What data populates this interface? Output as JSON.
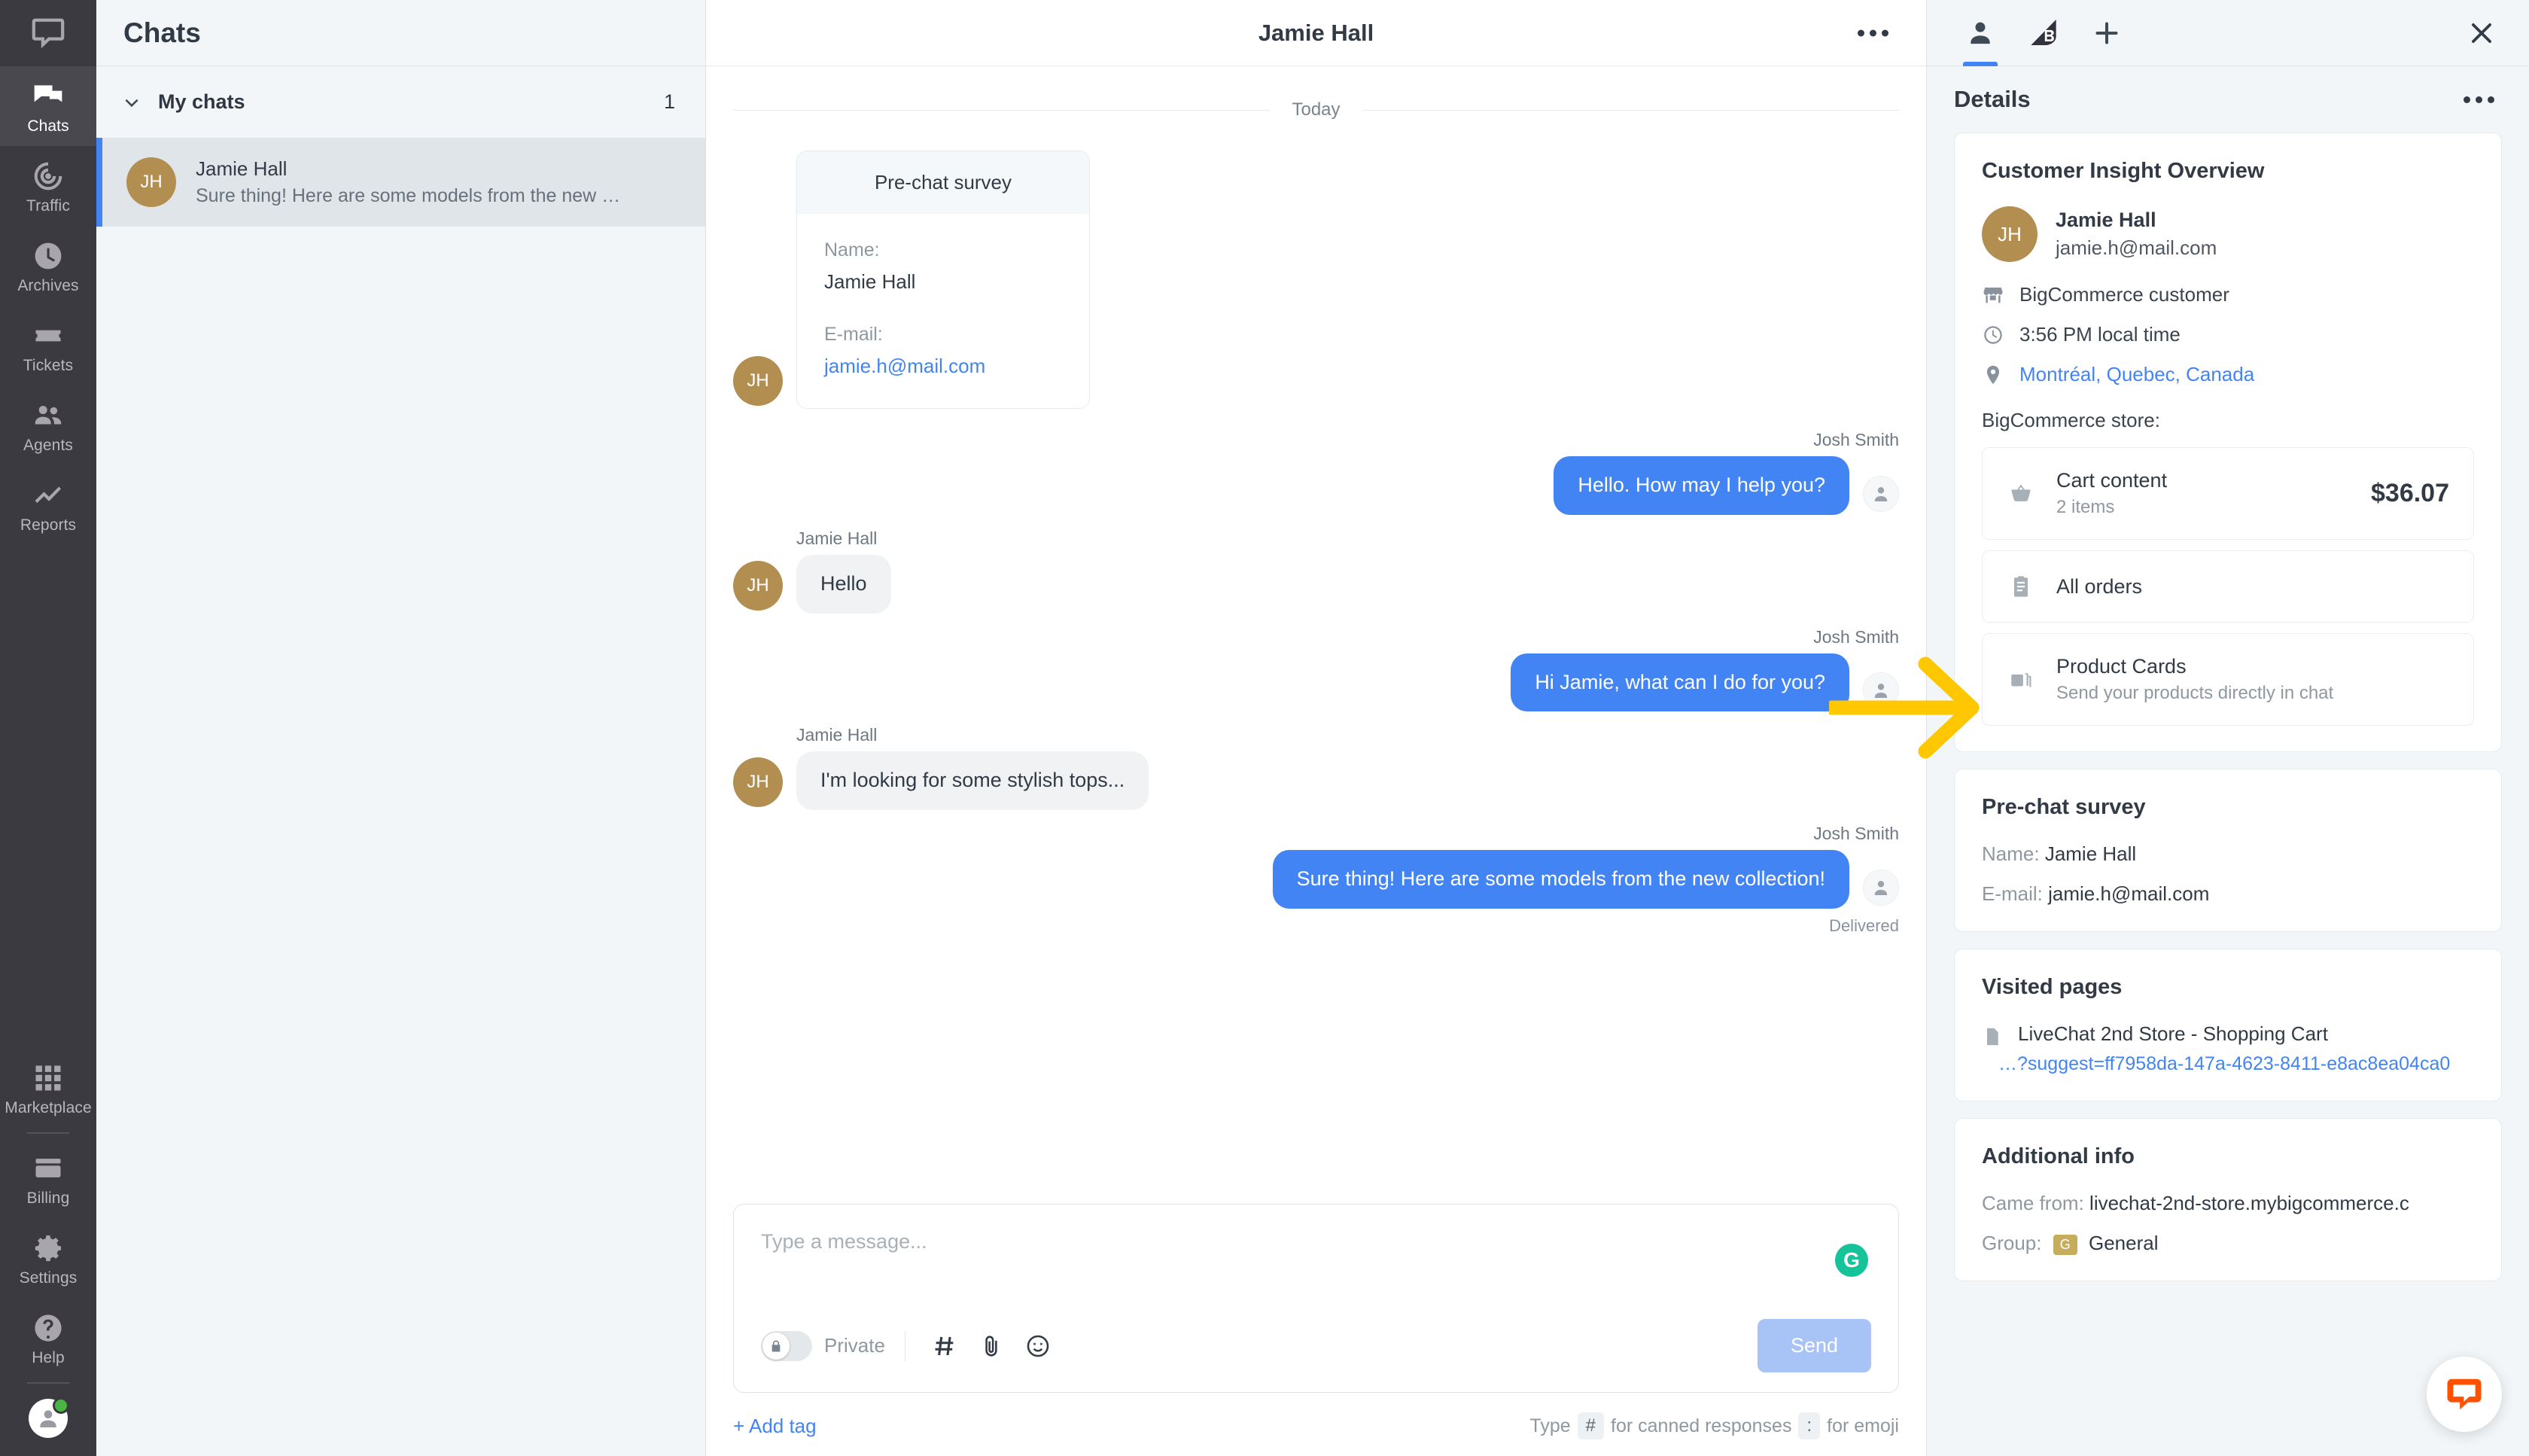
{
  "colors": {
    "accent_blue": "#4384F5",
    "rail_bg": "#3B3A40",
    "panel_bg": "#F2F6F8",
    "avatar_gold": "#B28E50",
    "grammarly_green": "#15C39A",
    "livechat_orange": "#FF5100",
    "annotation_yellow": "#FFC700",
    "group_badge": "#C6AD5E"
  },
  "rail": {
    "logo_icon": "livechat-logo-icon",
    "items": [
      {
        "label": "Chats",
        "icon": "chats-icon",
        "active": true
      },
      {
        "label": "Traffic",
        "icon": "traffic-icon",
        "active": false
      },
      {
        "label": "Archives",
        "icon": "archives-clock-icon",
        "active": false
      },
      {
        "label": "Tickets",
        "icon": "tickets-icon",
        "active": false
      },
      {
        "label": "Agents",
        "icon": "agents-people-icon",
        "active": false
      },
      {
        "label": "Reports",
        "icon": "reports-chart-icon",
        "active": false
      }
    ],
    "bottom_items": [
      {
        "label": "Marketplace",
        "icon": "marketplace-grid-icon"
      },
      {
        "label": "Billing",
        "icon": "billing-card-icon"
      },
      {
        "label": "Settings",
        "icon": "gear-icon"
      },
      {
        "label": "Help",
        "icon": "help-question-icon"
      }
    ],
    "profile": {
      "icon": "user-avatar-icon",
      "status": "online"
    }
  },
  "chatlist": {
    "title": "Chats",
    "section": {
      "label": "My chats",
      "count": "1",
      "chevron": "chevron-down-icon"
    },
    "items": [
      {
        "initials": "JH",
        "name": "Jamie Hall",
        "preview": "Sure thing! Here are some models from the new …",
        "selected": true
      }
    ]
  },
  "chat": {
    "header": {
      "title": "Jamie Hall",
      "menu_icon": "more-options-icon"
    },
    "day_divider": "Today",
    "survey_card": {
      "title": "Pre-chat survey",
      "name_label": "Name:",
      "name_value": "Jamie Hall",
      "email_label": "E-mail:",
      "email_value": "jamie.h@mail.com"
    },
    "messages": [
      {
        "sender": "Josh Smith",
        "side": "right",
        "text": "Hello. How may I help you?",
        "avatar_icon": "agent-avatar-icon"
      },
      {
        "sender": "Jamie Hall",
        "side": "left",
        "text": "Hello",
        "initials": "JH"
      },
      {
        "sender": "Josh Smith",
        "side": "right",
        "text": "Hi Jamie, what can I do for you?",
        "avatar_icon": "agent-avatar-icon"
      },
      {
        "sender": "Jamie Hall",
        "side": "left",
        "text": "I'm looking for some stylish tops...",
        "initials": "JH"
      },
      {
        "sender": "Josh Smith",
        "side": "right",
        "text": "Sure thing! Here are some models from the new collection!",
        "avatar_icon": "agent-avatar-icon",
        "status": "Delivered"
      }
    ],
    "composer": {
      "placeholder": "Type a message...",
      "grammarly_icon": "grammarly-icon",
      "grammarly_letter": "G",
      "private_label": "Private",
      "private_toggle": "off",
      "lock_icon": "lock-icon",
      "canned_icon": "hash-icon",
      "attach_icon": "paperclip-icon",
      "emoji_icon": "emoji-smiley-icon",
      "send_label": "Send",
      "add_tag_label": "+ Add tag",
      "hint_prefix": "Type",
      "hint_hash": "#",
      "hint_middle": "for canned responses",
      "hint_colon": ":",
      "hint_suffix": "for emoji"
    }
  },
  "details": {
    "tabs": [
      {
        "name": "customer-details-tab",
        "icon": "person-icon",
        "active": true
      },
      {
        "name": "bigcommerce-tab",
        "icon": "bigcommerce-logo-icon",
        "active": false
      },
      {
        "name": "add-integration-tab",
        "icon": "plus-icon",
        "active": false
      }
    ],
    "close_icon": "close-icon",
    "title": "Details",
    "menu_icon": "more-options-icon",
    "customer_insight": {
      "title": "Customer Insight Overview",
      "initials": "JH",
      "name": "Jamie Hall",
      "email": "jamie.h@mail.com",
      "meta": [
        {
          "icon": "store-icon",
          "text": "BigCommerce customer",
          "link": false
        },
        {
          "icon": "clock-icon",
          "text": "3:56 PM local time",
          "link": false
        },
        {
          "icon": "location-pin-icon",
          "text": "Montréal, Quebec, Canada",
          "link": true
        }
      ],
      "store_label": "BigCommerce store:",
      "store_items": [
        {
          "icon": "basket-icon",
          "name": "Cart content",
          "sub": "2 items",
          "amount": "$36.07"
        },
        {
          "icon": "clipboard-icon",
          "name": "All orders",
          "sub": "",
          "amount": ""
        },
        {
          "icon": "cards-icon",
          "name": "Product Cards",
          "sub": "Send your products directly in chat",
          "amount": ""
        }
      ]
    },
    "prechat": {
      "title": "Pre-chat survey",
      "name_label": "Name:",
      "name_value": "Jamie Hall",
      "email_label": "E-mail:",
      "email_value": "jamie.h@mail.com"
    },
    "visited": {
      "title": "Visited pages",
      "page_icon": "page-document-icon",
      "page_name": "LiveChat 2nd Store - Shopping Cart",
      "page_url": "…?suggest=ff7958da-147a-4623-8411-e8ac8ea04ca0"
    },
    "additional": {
      "title": "Additional info",
      "came_from_label": "Came from:",
      "came_from_value": "livechat-2nd-store.mybigcommerce.c",
      "group_label": "Group:",
      "group_badge": "G",
      "group_value": "General"
    },
    "widget_icon": "livechat-bubble-icon"
  },
  "annotation": {
    "type": "arrow",
    "direction": "right",
    "points_to": "All orders",
    "color": "#FFC700"
  }
}
